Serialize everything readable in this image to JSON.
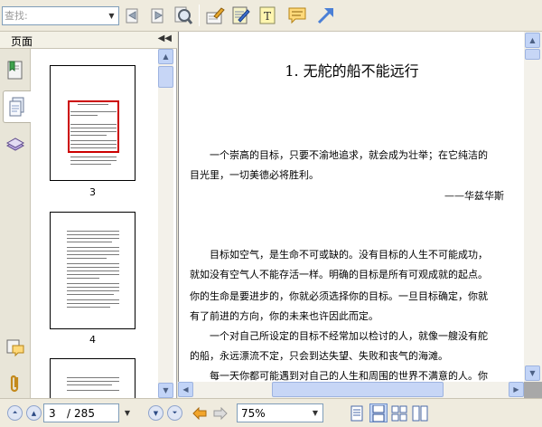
{
  "toolbar": {
    "search": {
      "placeholder": "查找:"
    },
    "buttons": [
      {
        "name": "find-previous-icon"
      },
      {
        "name": "find-next-icon"
      },
      {
        "name": "find-icon"
      },
      {
        "name": "highlight-tool-icon"
      },
      {
        "name": "notes-tool-icon"
      },
      {
        "name": "text-tool-icon"
      },
      {
        "name": "comment-tool-icon"
      },
      {
        "name": "arrow-tool-icon"
      }
    ]
  },
  "left_panel": {
    "title": "页面",
    "collapse_icon": "double-chevron-left-icon",
    "tabs": [
      {
        "name": "bookmark-icon"
      },
      {
        "name": "pages-icon",
        "active": true
      },
      {
        "name": "layers-icon"
      },
      {
        "name": "comments-icon"
      },
      {
        "name": "attachment-icon"
      }
    ],
    "thumbnails": [
      {
        "label": "3"
      },
      {
        "label": "4"
      }
    ]
  },
  "document": {
    "title": "1. 无舵的船不能远行",
    "paragraphs": [
      {
        "text": "一个崇高的目标，只要不渝地追求，就会成为壮举；在它纯洁的",
        "indent": true
      },
      {
        "text": "目光里，一切美德必将胜利。",
        "indent": false
      },
      {
        "text": "——华兹华斯",
        "align": "right"
      },
      {
        "text": "目标如空气，是生命不可或缺的。没有目标的人生不可能成功，",
        "indent": true
      },
      {
        "text": "就如没有空气人不能存活一样。明确的目标是所有可观成就的起点。",
        "indent": false
      },
      {
        "text": "你的生命是要进步的，你就必须选择你的目标。一旦目标确定，你就",
        "indent": false
      },
      {
        "text": "有了前进的方向，你的未来也许因此而定。",
        "indent": false
      },
      {
        "text": "一个对自己所设定的目标不经常加以检讨的人，就像一艘没有舵",
        "indent": true
      },
      {
        "text": "的船，永远漂流不定，只会到达失望、失败和丧气的海滩。",
        "indent": false
      },
      {
        "text": "每一天你都可能遇到对自己的人生和周围的世界不满意的人。你",
        "indent": true
      }
    ]
  },
  "statusbar": {
    "page_current": "3",
    "page_separator": "/",
    "page_total": "285",
    "zoom": "75%"
  },
  "colors": {
    "chrome": "#efebde",
    "scroll_accent": "#c2d4f7",
    "highlight_red": "#cc0000"
  }
}
